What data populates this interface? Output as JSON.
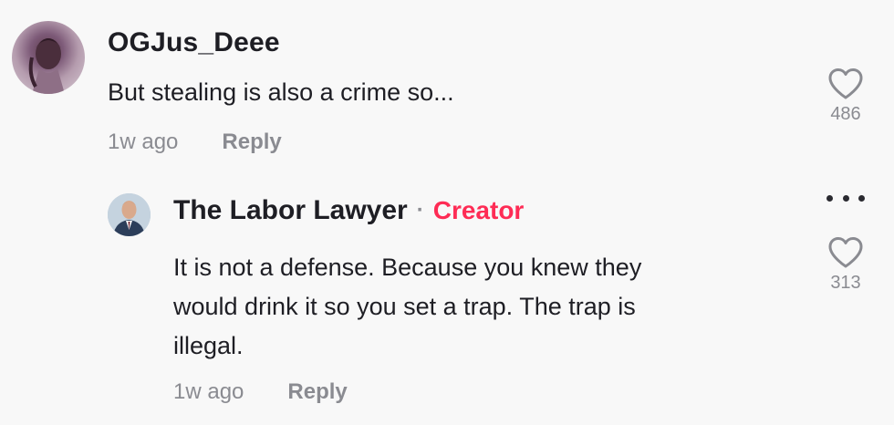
{
  "comments": [
    {
      "username": "OGJus_Deee",
      "text": "But stealing is also a crime so...",
      "time": "1w ago",
      "reply_label": "Reply",
      "likes": "486"
    }
  ],
  "reply": {
    "username": "The Labor Lawyer",
    "separator": "·",
    "badge": "Creator",
    "text_lines": [
      "It is not a defense. Because you knew they",
      "would drink it so you set a trap. The trap is",
      "illegal."
    ],
    "time": "1w ago",
    "reply_label": "Reply",
    "likes": "313"
  },
  "icons": {
    "like": "heart-outline-icon",
    "more": "more-horizontal-icon"
  },
  "colors": {
    "background": "#f8f8f8",
    "creator_badge": "#fe2c55",
    "meta_text": "#8a8b91",
    "primary_text": "#1e1e24"
  }
}
